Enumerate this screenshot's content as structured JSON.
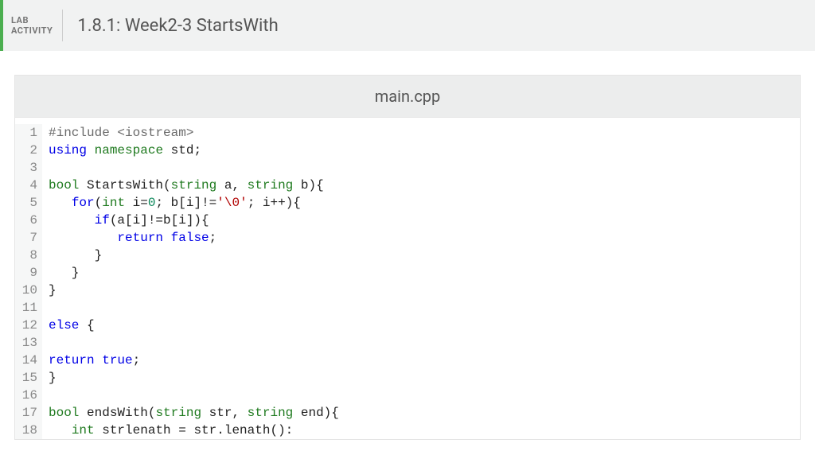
{
  "header": {
    "label_line1": "LAB",
    "label_line2": "ACTIVITY",
    "title": "1.8.1: Week2-3 StartsWith"
  },
  "editor": {
    "filename": "main.cpp",
    "lines": [
      {
        "n": 1,
        "tokens": [
          [
            "pre",
            "#include <iostream>"
          ]
        ]
      },
      {
        "n": 2,
        "tokens": [
          [
            "keyword",
            "using"
          ],
          [
            "plain",
            " "
          ],
          [
            "type",
            "namespace"
          ],
          [
            "plain",
            " "
          ],
          [
            "plain",
            "std;"
          ]
        ]
      },
      {
        "n": 3,
        "tokens": []
      },
      {
        "n": 4,
        "tokens": [
          [
            "type",
            "bool"
          ],
          [
            "plain",
            " "
          ],
          [
            "plain",
            "StartsWith("
          ],
          [
            "type",
            "string"
          ],
          [
            "plain",
            " a, "
          ],
          [
            "type",
            "string"
          ],
          [
            "plain",
            " b){"
          ]
        ]
      },
      {
        "n": 5,
        "indent": 1,
        "tokens": [
          [
            "plain",
            "   "
          ],
          [
            "keyword",
            "for"
          ],
          [
            "plain",
            "("
          ],
          [
            "type",
            "int"
          ],
          [
            "plain",
            " i="
          ],
          [
            "number",
            "0"
          ],
          [
            "plain",
            "; b[i]!="
          ],
          [
            "string",
            "'\\0'"
          ],
          [
            "plain",
            "; i++){"
          ]
        ]
      },
      {
        "n": 6,
        "indent": 2,
        "tokens": [
          [
            "plain",
            "      "
          ],
          [
            "keyword",
            "if"
          ],
          [
            "plain",
            "(a[i]!=b[i]){"
          ]
        ]
      },
      {
        "n": 7,
        "indent": 3,
        "tokens": [
          [
            "plain",
            "         "
          ],
          [
            "keyword",
            "return"
          ],
          [
            "plain",
            " "
          ],
          [
            "bool",
            "false"
          ],
          [
            "plain",
            ";"
          ]
        ]
      },
      {
        "n": 8,
        "indent": 2,
        "tokens": [
          [
            "plain",
            "      }"
          ]
        ]
      },
      {
        "n": 9,
        "indent": 1,
        "tokens": [
          [
            "plain",
            "   }"
          ]
        ]
      },
      {
        "n": 10,
        "tokens": [
          [
            "plain",
            "}"
          ]
        ]
      },
      {
        "n": 11,
        "tokens": []
      },
      {
        "n": 12,
        "tokens": [
          [
            "keyword",
            "else"
          ],
          [
            "plain",
            " {"
          ]
        ]
      },
      {
        "n": 13,
        "tokens": []
      },
      {
        "n": 14,
        "tokens": [
          [
            "keyword",
            "return"
          ],
          [
            "plain",
            " "
          ],
          [
            "bool",
            "true"
          ],
          [
            "plain",
            ";"
          ]
        ]
      },
      {
        "n": 15,
        "tokens": [
          [
            "plain",
            "}"
          ]
        ]
      },
      {
        "n": 16,
        "tokens": []
      },
      {
        "n": 17,
        "tokens": [
          [
            "type",
            "bool"
          ],
          [
            "plain",
            " "
          ],
          [
            "plain",
            "endsWith("
          ],
          [
            "type",
            "string"
          ],
          [
            "plain",
            " str, "
          ],
          [
            "type",
            "string"
          ],
          [
            "plain",
            " end){"
          ]
        ]
      },
      {
        "n": 18,
        "tokens": [
          [
            "plain",
            "   "
          ],
          [
            "type",
            "int"
          ],
          [
            "plain",
            " strlenath = str.lenath():"
          ]
        ]
      }
    ]
  }
}
